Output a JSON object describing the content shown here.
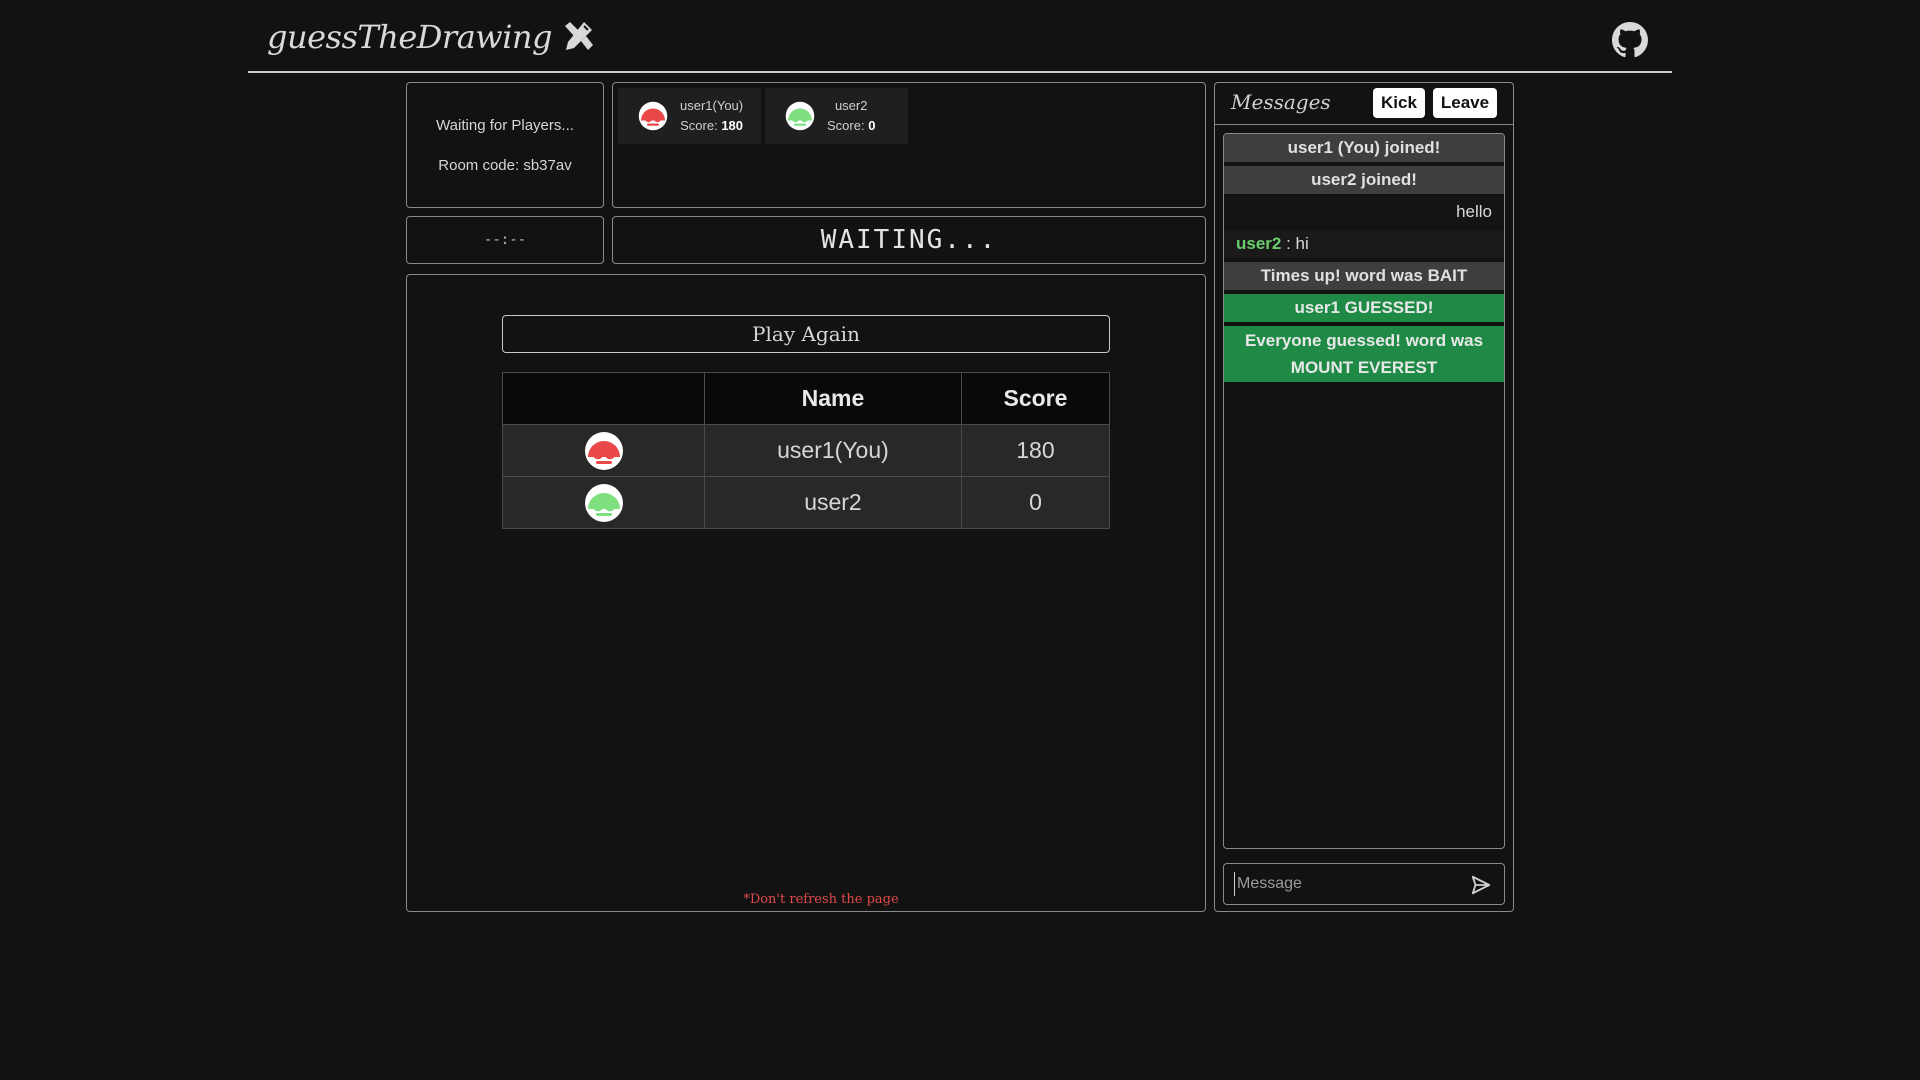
{
  "header": {
    "brand": "guessTheDrawing",
    "brand_icon": "pencil-ruler-icon",
    "github_icon": "github-icon"
  },
  "status": {
    "waiting_text": "Waiting for Players...",
    "room_code_text": "Room code: sb37av"
  },
  "players": [
    {
      "name": "user1(You)",
      "score_label": "Score:",
      "score": "180",
      "color": "#e84848"
    },
    {
      "name": "user2",
      "score_label": "Score:",
      "score": "0",
      "color": "#7fe07f"
    }
  ],
  "timer": "--:--",
  "word": "WAITING...",
  "game": {
    "play_again_label": "Play Again",
    "table": {
      "headers": [
        "",
        "Name",
        "Score"
      ],
      "rows": [
        {
          "name": "user1(You)",
          "score": "180",
          "color": "#e84848"
        },
        {
          "name": "user2",
          "score": "0",
          "color": "#7fe07f"
        }
      ]
    },
    "warning": "*Don't refresh the page"
  },
  "messages": {
    "title": "Messages",
    "kick_label": "Kick",
    "leave_label": "Leave",
    "items": [
      {
        "type": "sys",
        "text": "user1 (You) joined!"
      },
      {
        "type": "sys",
        "text": "user2 joined!"
      },
      {
        "type": "mine",
        "text": "hello"
      },
      {
        "type": "user",
        "user": "user2",
        "sep": " : ",
        "text": "hi"
      },
      {
        "type": "sys",
        "text": "Times up! word was BAIT"
      },
      {
        "type": "green",
        "text": "user1 GUESSED!"
      },
      {
        "type": "green",
        "text": "Everyone guessed! word was MOUNT EVEREST"
      }
    ],
    "input_placeholder": "Message",
    "send_icon": "send-icon"
  },
  "colors": {
    "background": "#121212",
    "guessed_green": "#1e8a45",
    "warning_red": "#e14a4a",
    "system_message_bg": "#3e3e3e"
  }
}
